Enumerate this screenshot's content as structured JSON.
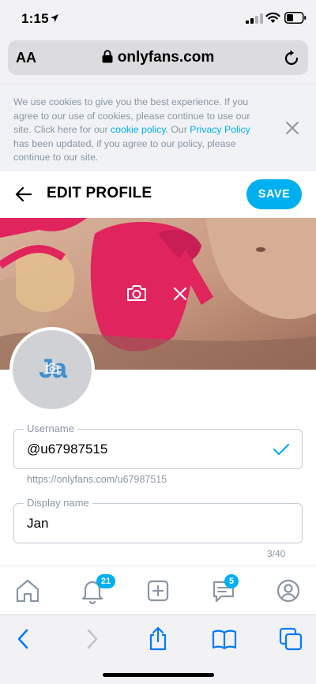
{
  "status_bar": {
    "time": "1:15"
  },
  "browser": {
    "text_size_label": "AA",
    "domain": "onlyfans.com"
  },
  "cookie_banner": {
    "text_1": "We use cookies to give you the best experience. If you agree to our use of cookies, please continue to use our site. Click here for our ",
    "cookie_link": "cookie policy",
    "text_2": ". Our ",
    "privacy_link": "Privacy Policy",
    "text_3": " has been updated, if you agree to our policy, please continue to our site."
  },
  "header": {
    "title": "EDIT PROFILE",
    "save_label": "SAVE"
  },
  "avatar": {
    "initials": "Ja"
  },
  "username_field": {
    "label": "Username",
    "value": "@u67987515",
    "hint": "https://onlyfans.com/u67987515"
  },
  "display_name_field": {
    "label": "Display name",
    "value": "Jan",
    "counter": "3/40"
  },
  "app_nav": {
    "items": [
      {
        "icon": "home-icon"
      },
      {
        "icon": "bell-icon",
        "badge": "21"
      },
      {
        "icon": "plus-square-icon"
      },
      {
        "icon": "messages-icon",
        "badge": "5"
      },
      {
        "icon": "profile-icon"
      }
    ]
  },
  "colors": {
    "accent": "#00aff0",
    "muted_text": "#8a96a3",
    "cover_pink": "#e0245e"
  }
}
